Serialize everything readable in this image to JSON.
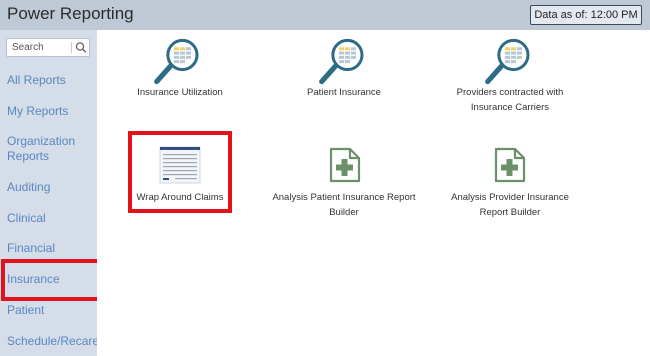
{
  "header": {
    "title": "Power Reporting",
    "data_as_of": "Data as of: 12:00 PM"
  },
  "search": {
    "placeholder": "Search"
  },
  "sidebar": {
    "items": [
      {
        "label": "All Reports"
      },
      {
        "label": "My Reports"
      },
      {
        "label": "Organization Reports"
      },
      {
        "label": "Auditing"
      },
      {
        "label": "Clinical"
      },
      {
        "label": "Financial"
      },
      {
        "label": "Insurance"
      },
      {
        "label": "Patient"
      },
      {
        "label": "Schedule/Recare"
      }
    ],
    "selected": "Insurance"
  },
  "reports": [
    {
      "label": "Insurance Utilization",
      "icon": "magnifier-report-icon"
    },
    {
      "label": "Patient Insurance",
      "icon": "magnifier-report-icon"
    },
    {
      "label": "Providers contracted with Insurance Carriers",
      "icon": "magnifier-report-icon"
    },
    {
      "label": "Wrap Around Claims",
      "icon": "document-list-icon"
    },
    {
      "label": "Analysis Patient Insurance Report Builder",
      "icon": "report-builder-plus-icon"
    },
    {
      "label": "Analysis Provider Insurance Report Builder",
      "icon": "report-builder-plus-icon"
    }
  ],
  "colors": {
    "header_bg": "#bfc9d6",
    "sidebar_bg": "#d5dde8",
    "nav_link": "#5a86c2",
    "highlight": "#e3111a",
    "icon_teal": "#2e6b86",
    "icon_green": "#5d8a5b"
  }
}
